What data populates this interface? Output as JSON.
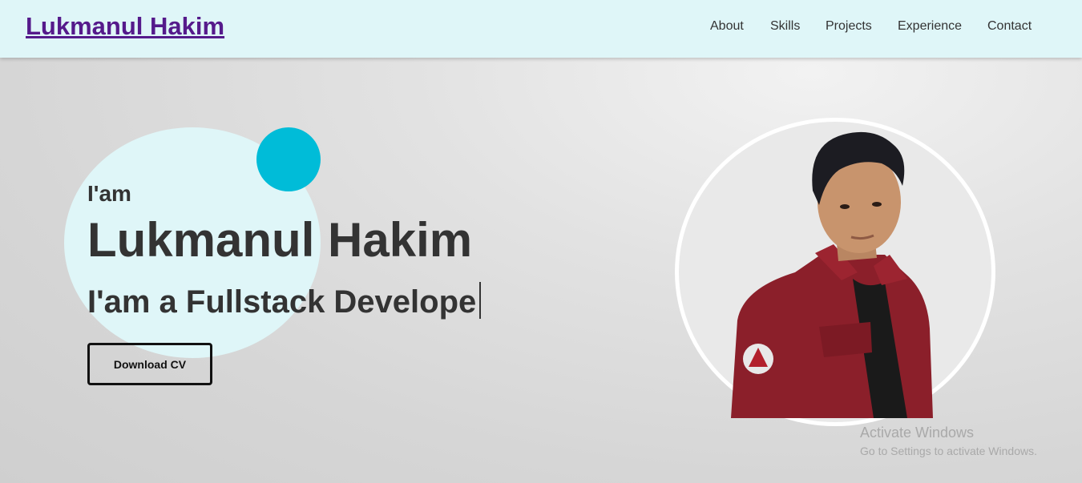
{
  "header": {
    "brand": "Lukmanul Hakim",
    "nav": [
      "About",
      "Skills",
      "Projects",
      "Experience",
      "Contact"
    ]
  },
  "hero": {
    "intro": "I'am",
    "name": "Lukmanul Hakim",
    "role": "I'am a Fullstack Develope",
    "cv_button": "Download CV"
  },
  "watermark": {
    "title": "Activate Windows",
    "subtitle": "Go to Settings to activate Windows."
  },
  "colors": {
    "nav_bg": "#dff6f8",
    "brand_link": "#551a8b",
    "accent_dot": "#00bcd8",
    "text": "#333333",
    "jacket": "#8b1f2a"
  }
}
